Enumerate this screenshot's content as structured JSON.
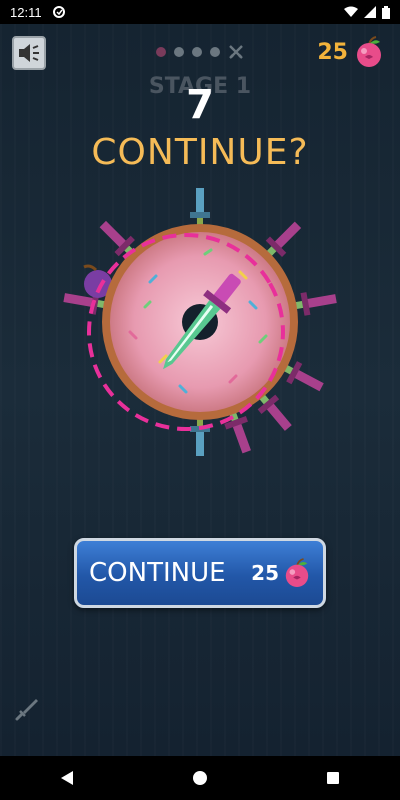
{
  "status_bar": {
    "time": "12:11"
  },
  "hud": {
    "stage_label": "STAGE 1",
    "apple_count": "25",
    "progress_dots": 4
  },
  "popup": {
    "countdown": "7",
    "title": "CONTINUE?",
    "continue_label": "CONTINUE",
    "continue_cost": "25"
  },
  "colors": {
    "accent_orange": "#f5bb57",
    "button_blue": "#2a62b5",
    "apple_pink": "#e84c8a",
    "dashed_ring": "#e8309a"
  },
  "icons": {
    "sound": "speaker-icon",
    "apple": "apple-icon",
    "boss": "crossed-swords-icon",
    "knife_shop": "knife-icon",
    "nav_back": "back-triangle-icon",
    "nav_home": "home-circle-icon",
    "nav_recents": "recents-square-icon"
  }
}
